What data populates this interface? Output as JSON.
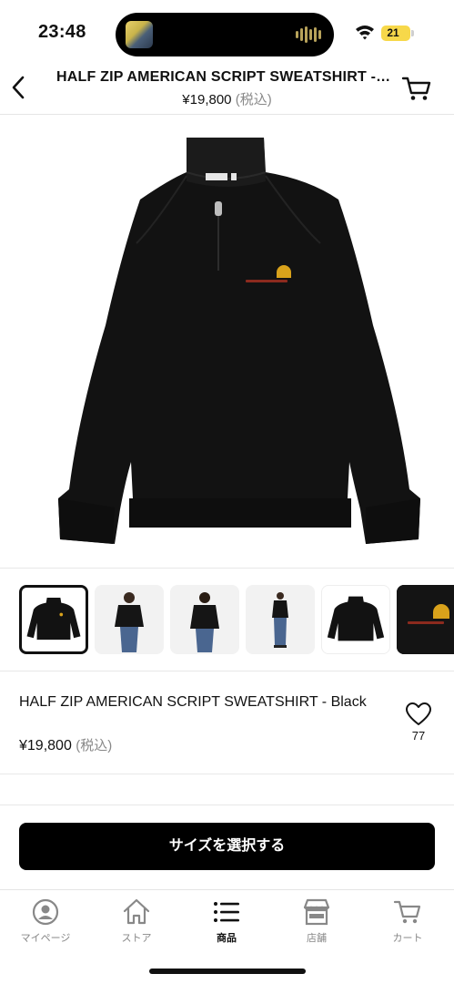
{
  "status_bar": {
    "time": "23:48",
    "battery": "21"
  },
  "header": {
    "title": "HALF ZIP AMERICAN SCRIPT SWEATSHIRT - Black",
    "price": "¥19,800",
    "tax": "(税込)",
    "back_icon": "chevron-left-icon",
    "cart_icon": "cart-icon"
  },
  "product": {
    "name": "HALF ZIP AMERICAN SCRIPT SWEATSHIRT - Black",
    "price": "¥19,800",
    "tax": "(税込)",
    "favorite_count": "77",
    "colors": {
      "garment": "#111111",
      "logo": "#d9a21b",
      "script": "#8c2a1e"
    }
  },
  "thumbnails": [
    {
      "kind": "front",
      "selected": true
    },
    {
      "kind": "model-front",
      "selected": false
    },
    {
      "kind": "model-back",
      "selected": false
    },
    {
      "kind": "model-full",
      "selected": false
    },
    {
      "kind": "back",
      "selected": false
    },
    {
      "kind": "detail",
      "selected": false
    }
  ],
  "cta": {
    "label": "サイズを選択する"
  },
  "tabbar": {
    "items": [
      {
        "label": "マイページ",
        "icon": "user-icon",
        "active": false
      },
      {
        "label": "ストア",
        "icon": "home-icon",
        "active": false
      },
      {
        "label": "商品",
        "icon": "list-icon",
        "active": true
      },
      {
        "label": "店舗",
        "icon": "store-icon",
        "active": false
      },
      {
        "label": "カート",
        "icon": "cart-icon",
        "active": false
      }
    ]
  }
}
